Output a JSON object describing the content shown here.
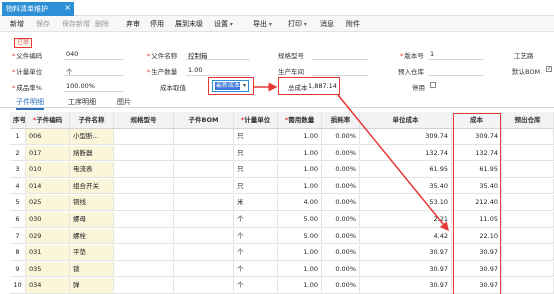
{
  "window": {
    "tab_title": "物料清单维护",
    "close_glyph": "×"
  },
  "toolbar": [
    {
      "label": "新增",
      "disabled": false,
      "dropdown": false
    },
    {
      "label": "保存",
      "disabled": true,
      "dropdown": false
    },
    {
      "label": "保存新增",
      "disabled": true,
      "dropdown": false
    },
    {
      "label": "删除",
      "disabled": true,
      "dropdown": false
    },
    {
      "label": "弃审",
      "disabled": false,
      "dropdown": false
    },
    {
      "label": "停用",
      "disabled": false,
      "dropdown": false
    },
    {
      "label": "展到末级",
      "disabled": false,
      "dropdown": false
    },
    {
      "label": "设置",
      "disabled": false,
      "dropdown": true
    },
    {
      "label": "导出",
      "disabled": false,
      "dropdown": true
    },
    {
      "label": "打印",
      "disabled": false,
      "dropdown": true
    },
    {
      "label": "消息",
      "disabled": false,
      "dropdown": false
    },
    {
      "label": "附件",
      "disabled": false,
      "dropdown": false
    }
  ],
  "status_button": "已审",
  "form": {
    "parent_code_label": "父件编码",
    "parent_code": "040",
    "parent_name_label": "父件名称",
    "parent_name": "控制箱",
    "spec_label": "规格型号",
    "version_label": "版本号",
    "version": "1",
    "process_route_label": "工艺路",
    "unit_label": "计量单位",
    "unit": "个",
    "prod_qty_label": "生产数量",
    "prod_qty": "1.00",
    "workshop_label": "生产车间",
    "warehouse_label": "预入仓库",
    "default_bom_label": "默认BOM",
    "yield_label": "成品率%",
    "yield": "100.00%",
    "cost_method_label": "成本取值",
    "cost_method": "最新成本",
    "total_cost_label": "总成本",
    "total_cost": "1,887.14",
    "disabled_label": "停用"
  },
  "subtabs": [
    "子件明细",
    "工序明细",
    "图片"
  ],
  "grid": {
    "headers": [
      "序号",
      "子件编码",
      "子件名称",
      "规格型号",
      "子件BOM",
      "计量单位",
      "需用数量",
      "损耗率",
      "单位成本",
      "成本",
      "预出仓库"
    ],
    "required_headers": [
      1,
      5,
      6
    ],
    "rows": [
      [
        "1",
        "006",
        "小型断...",
        "",
        "",
        "只",
        "1.00",
        "0.00%",
        "309.74",
        "309.74",
        ""
      ],
      [
        "2",
        "017",
        "熔断器",
        "",
        "",
        "只",
        "1.00",
        "0.00%",
        "132.74",
        "132.74",
        ""
      ],
      [
        "3",
        "010",
        "电流表",
        "",
        "",
        "只",
        "1.00",
        "0.00%",
        "61.95",
        "61.95",
        ""
      ],
      [
        "4",
        "014",
        "组合开关",
        "",
        "",
        "只",
        "1.00",
        "0.00%",
        "35.40",
        "35.40",
        ""
      ],
      [
        "5",
        "025",
        "铜线",
        "",
        "",
        "米",
        "4.00",
        "0.00%",
        "53.10",
        "212.40",
        ""
      ],
      [
        "6",
        "030",
        "螺母",
        "",
        "",
        "个",
        "5.00",
        "0.00%",
        "2.21",
        "11.05",
        ""
      ],
      [
        "7",
        "029",
        "螺栓",
        "",
        "",
        "个",
        "5.00",
        "0.00%",
        "4.42",
        "22.10",
        ""
      ],
      [
        "8",
        "031",
        "平垫",
        "",
        "",
        "个",
        "1.00",
        "0.00%",
        "30.97",
        "30.97",
        ""
      ],
      [
        "9",
        "035",
        "锁",
        "",
        "",
        "个",
        "1.00",
        "0.00%",
        "30.97",
        "30.97",
        ""
      ],
      [
        "10",
        "034",
        "弹",
        "",
        "",
        "个",
        "1.00",
        "0.00%",
        "30.97",
        "30.97",
        ""
      ]
    ]
  },
  "colors": {
    "accent": "#2d8fd5",
    "highlight": "#e53935",
    "row_yellow": "#fbf5da"
  }
}
